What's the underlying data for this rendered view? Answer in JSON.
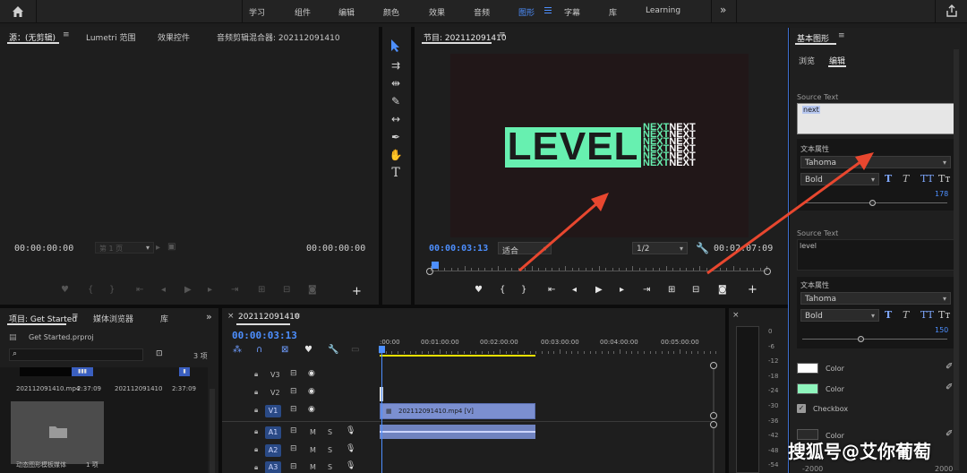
{
  "topbar": {
    "workspaces": [
      "学习",
      "组件",
      "编辑",
      "颜色",
      "效果",
      "音频",
      "图形",
      "字幕",
      "库",
      "Learning"
    ],
    "active_workspace": "图形"
  },
  "source_panel": {
    "tabs": [
      "源：(无剪辑)",
      "Lumetri 范围",
      "效果控件",
      "音频剪辑混合器: 202112091410"
    ],
    "tc_left": "00:00:00:00",
    "tc_right": "00:00:00:00",
    "page_select": "第 1 页"
  },
  "program_monitor": {
    "title": "节目: 202112091410",
    "timecode": "00:00:03:13",
    "fit": "适合",
    "resolution": "1/2",
    "duration": "00:02:07:09",
    "graphic_word": "LEVEL",
    "graphic_side_word": "NEXT",
    "playhead_fraction": 0.01
  },
  "project_panel": {
    "tabs": [
      "项目: Get Started",
      "媒体浏览器",
      "库"
    ],
    "project_file": "Get Started.prproj",
    "item_count": "3 项",
    "items": [
      {
        "name": "202112091410.mp4",
        "duration": "2:37:09"
      },
      {
        "name": "202112091410",
        "duration": "2:37:09"
      }
    ],
    "folder": {
      "name": "动态图形模板媒体",
      "count": "1 项"
    }
  },
  "timeline": {
    "tab": "202112091410",
    "timecode": "00:00:03:13",
    "ruler": [
      ":00:00",
      "00:01:00:00",
      "00:02:00:00",
      "00:03:00:00",
      "00:04:00:00",
      "00:05:00:00"
    ],
    "video_tracks": [
      "V3",
      "V2",
      "V1"
    ],
    "audio_tracks": [
      "A1",
      "A2",
      "A3"
    ],
    "track_buttons": {
      "mute": "M",
      "solo": "S"
    },
    "clip_name": "202112091410.mp4 [V]"
  },
  "meter": {
    "scale": [
      "0",
      "-6",
      "-12",
      "-18",
      "-24",
      "-30",
      "-36",
      "-42",
      "-48",
      "-54"
    ]
  },
  "essential_graphics": {
    "title": "基本图形",
    "tabs": [
      "浏览",
      "编辑"
    ],
    "active_tab": "编辑",
    "layers": [
      {
        "source_label": "Source Text",
        "source_value": "next",
        "props_label": "文本属性",
        "font": "Tahoma",
        "weight": "Bold",
        "size": "178",
        "slider_fraction": 0.48
      },
      {
        "source_label": "Source Text",
        "source_value": "level",
        "props_label": "文本属性",
        "font": "Tahoma",
        "weight": "Bold",
        "size": "150",
        "slider_fraction": 0.4
      }
    ],
    "style_buttons": [
      "T",
      "T",
      "TT",
      "Tт"
    ],
    "colors": [
      {
        "label": "Color",
        "value": "#ffffff"
      },
      {
        "label": "Color",
        "value": "#8ff5bd"
      }
    ],
    "checkbox_label": "Checkbox",
    "color3_label": "Color",
    "range_min": "-2000",
    "range_max": "2000"
  },
  "watermark": "搜狐号@艾你葡萄",
  "accent": "#4d8fff",
  "graphic_color": "#67f0b0",
  "arrow_color": "#e8472f"
}
